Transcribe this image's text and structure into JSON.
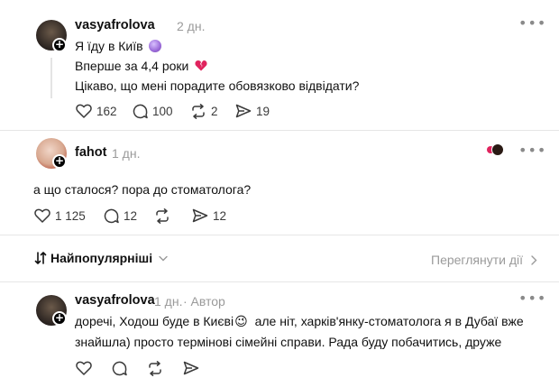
{
  "post": {
    "username": "vasyafrolova",
    "time": "2 дн.",
    "lines": [
      "Я їду в Київ",
      "Вперше за 4,4 роки",
      "Цікаво, що мені порадите обовязково відвідати?"
    ],
    "emojis": [
      "🔮",
      "💔"
    ],
    "likes": "162",
    "replies": "100",
    "reposts": "2",
    "shares": "19"
  },
  "reply1": {
    "username": "fahot",
    "time": "1 дн.",
    "text": "а що сталося? пора до стоматолога?",
    "likes": "1 125",
    "replies": "12",
    "shares": "12"
  },
  "sort": {
    "label": "Найпопулярніші",
    "activity_label": "Переглянути дії"
  },
  "reply2": {
    "username": "vasyafrolova",
    "time": "1 дн.",
    "author_badge": "· Автор",
    "line1_a": "доречі, Ходош буде в Києві",
    "emoji": "😉",
    "line1_b": "але ніт, харків'янку-стоматолога я в Дубаї вже",
    "line2": "знайшла) просто термінові сімейні справи. Рада буду побачитись, друже"
  },
  "icons": {
    "more": "more-horizontal-icon",
    "like": "heart-icon",
    "reply": "comment-icon",
    "repost": "repost-icon",
    "share": "send-icon",
    "follow": "plus-icon",
    "sort": "sort-arrows-icon",
    "chevron": "chevron-down-icon",
    "chevron_right": "chevron-right-icon"
  }
}
